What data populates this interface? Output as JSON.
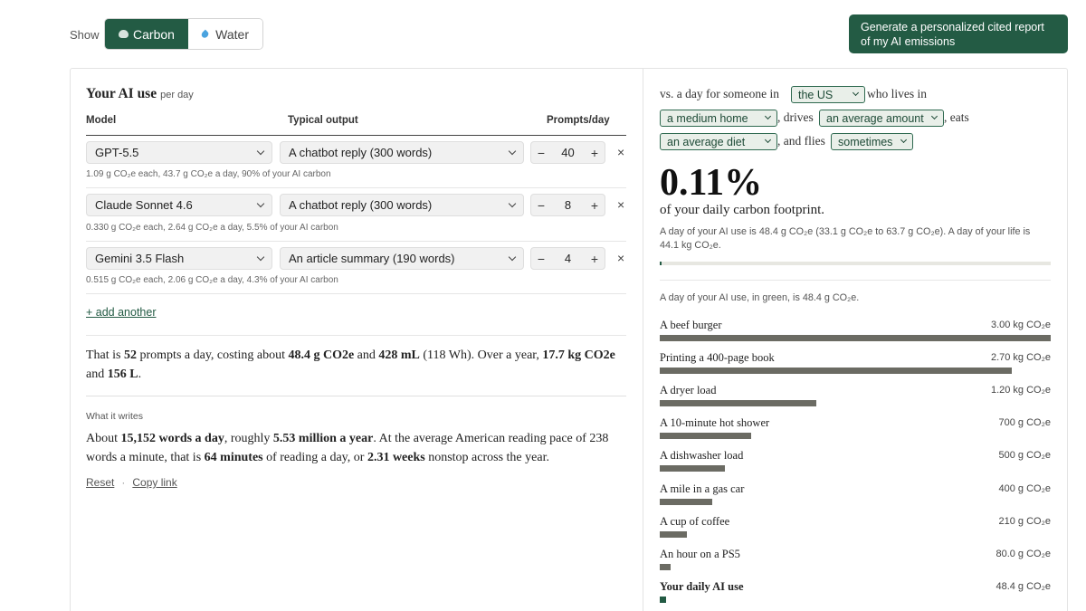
{
  "top": {
    "show_label": "Show",
    "tabs": [
      {
        "label": "Carbon",
        "active": true,
        "icon": "cloud-icon"
      },
      {
        "label": "Water",
        "active": false,
        "icon": "water-drop-icon"
      }
    ],
    "generate_button": "Generate a personalized cited report of my AI emissions"
  },
  "colors": {
    "accent": "#235b44",
    "bar": "#6b6b63"
  },
  "left": {
    "title": "Your AI use",
    "title_suffix": "per day",
    "columns": [
      "Model",
      "Typical output",
      "Prompts/day"
    ],
    "rows": [
      {
        "model": "GPT-5.5",
        "output": "A chatbot reply (300 words)",
        "prompts": "40",
        "note": "1.09 g CO₂e each, 43.7 g CO₂e a day, 90% of your AI carbon"
      },
      {
        "model": "Claude Sonnet 4.6",
        "output": "A chatbot reply (300 words)",
        "prompts": "8",
        "note": "0.330 g CO₂e each, 2.64 g CO₂e a day, 5.5% of your AI carbon"
      },
      {
        "model": "Gemini 3.5 Flash",
        "output": "An article summary (190 words)",
        "prompts": "4",
        "note": "0.515 g CO₂e each, 2.06 g CO₂e a day, 4.3% of your AI carbon"
      }
    ],
    "minus": "−",
    "plus": "+",
    "remove": "×",
    "add_link": "+ add another",
    "summary": {
      "t1": "That is ",
      "prompts": "52",
      "t2": " prompts a day, costing about ",
      "carbon": "48.4 g CO2e",
      "t3": " and ",
      "water": "428 mL",
      "t4": " (118 Wh). Over a year, ",
      "year_carbon": "17.7 kg CO2e",
      "t5": " and ",
      "year_water": "156 L",
      "t6": "."
    },
    "writes_label": "What it writes",
    "writes": {
      "t1": "About ",
      "words_day": "15,152 words a day",
      "t2": ", roughly ",
      "words_year": "5.53 million a year",
      "t3": ". At the average American reading pace of 238 words a minute, that is ",
      "minutes": "64 minutes",
      "t4": " of reading a day, or ",
      "weeks": "2.31 weeks",
      "t5": " nonstop across the year."
    },
    "reset": "Reset",
    "sep": "·",
    "copy_link": "Copy link"
  },
  "right": {
    "line1_a": "vs. a day for someone in",
    "country": "the US",
    "line1_b": "who lives in",
    "home": "a medium home",
    "line2_a": ", drives",
    "drive": "an average amount",
    "line2_b": ", eats",
    "diet": "an average diet",
    "line3_a": ", and flies",
    "flies": "sometimes",
    "percent": "0.11%",
    "percent_sub": "of your daily carbon footprint.",
    "percent_note": "A day of your AI use is 48.4 g CO₂e (33.1 g CO₂e to 63.7 g CO₂e). A day of your life is 44.1 kg CO₂e.",
    "percent_fraction": 0.0011,
    "list_intro": "A day of your AI use, in green, is 48.4 g CO₂e.",
    "comparisons": [
      {
        "label": "A beef burger",
        "value": "3.00 kg CO₂e",
        "grams": 3000
      },
      {
        "label": "Printing a 400-page book",
        "value": "2.70 kg CO₂e",
        "grams": 2700
      },
      {
        "label": "A dryer load",
        "value": "1.20 kg CO₂e",
        "grams": 1200
      },
      {
        "label": "A 10-minute hot shower",
        "value": "700 g CO₂e",
        "grams": 700
      },
      {
        "label": "A dishwasher load",
        "value": "500 g CO₂e",
        "grams": 500
      },
      {
        "label": "A mile in a gas car",
        "value": "400 g CO₂e",
        "grams": 400
      },
      {
        "label": "A cup of coffee",
        "value": "210 g CO₂e",
        "grams": 210
      },
      {
        "label": "An hour on a PS5",
        "value": "80.0 g CO₂e",
        "grams": 80
      },
      {
        "label": "Your daily AI use",
        "value": "48.4 g CO₂e",
        "grams": 48.4,
        "highlight": true
      }
    ]
  }
}
